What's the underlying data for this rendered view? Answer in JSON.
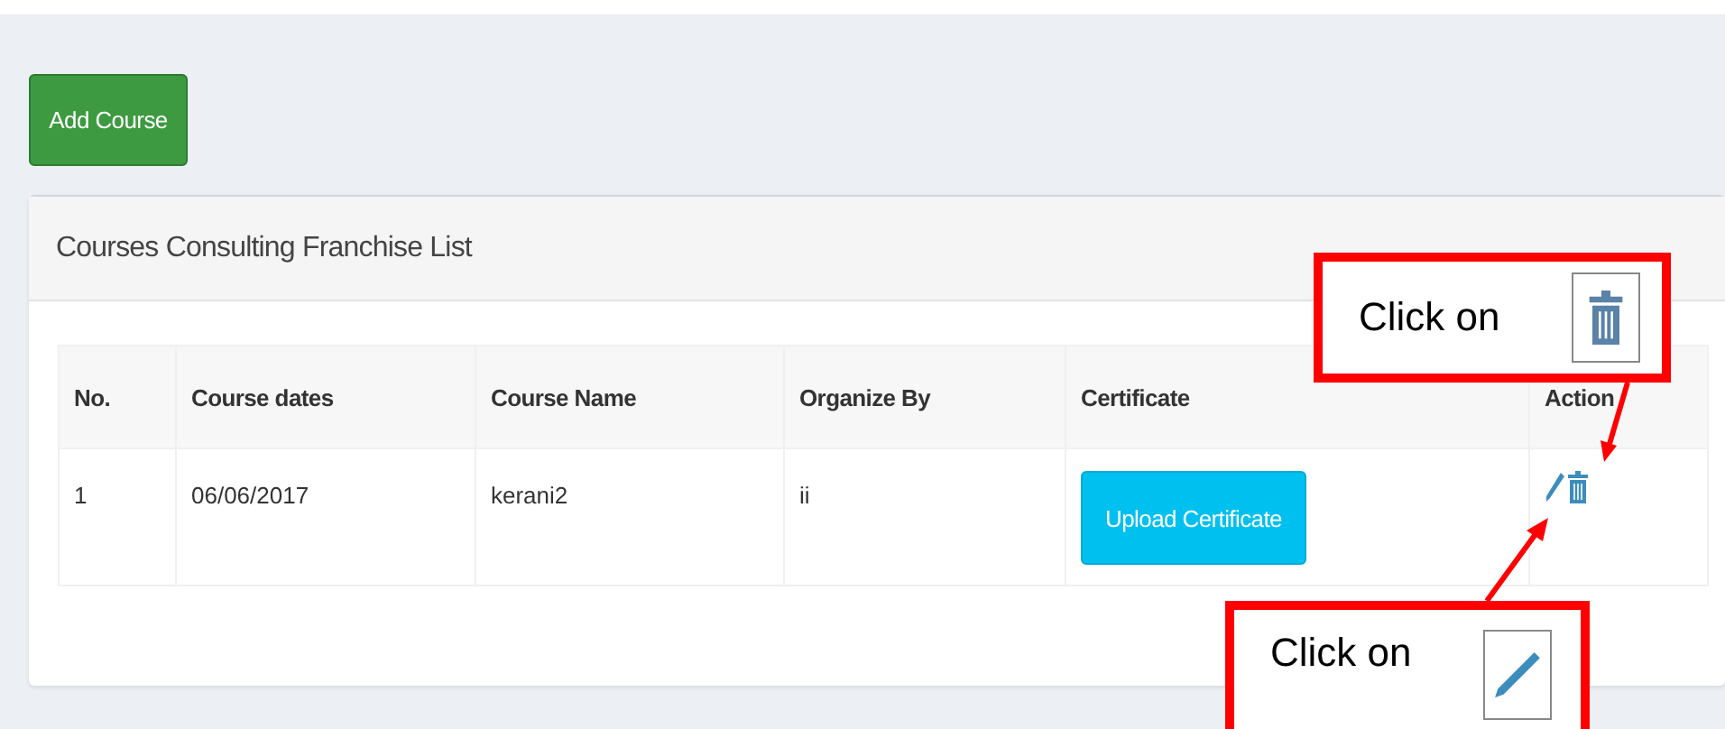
{
  "add_button": "Add Course",
  "panel": {
    "title": "Courses Consulting Franchise List",
    "table": {
      "columns": [
        "No.",
        "Course dates",
        "Course Name",
        "Organize By",
        "Certificate",
        "Action"
      ],
      "rows": [
        {
          "no": "1",
          "course_dates": "06/06/2017",
          "course_name": "kerani2",
          "organize_by": "ii",
          "certificate_button": "Upload Certificate"
        }
      ]
    }
  },
  "callouts": [
    {
      "kind": "delete",
      "text": "Click on"
    },
    {
      "kind": "edit",
      "text": "Click on"
    }
  ]
}
